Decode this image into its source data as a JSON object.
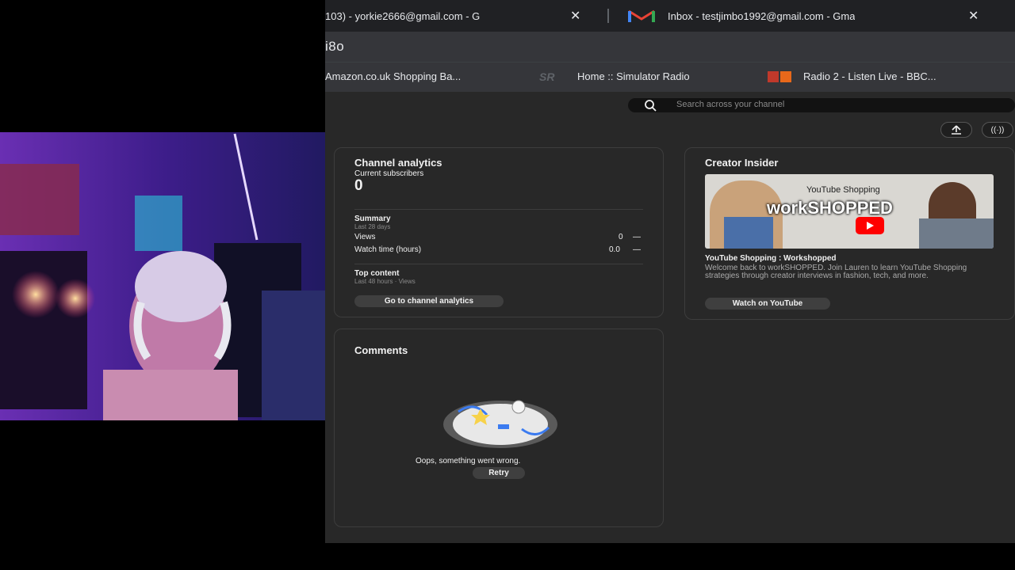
{
  "browser": {
    "tabs": [
      {
        "title": "103) - yorkie2666@gmail.com - G"
      },
      {
        "title": "Inbox - testjimbo1992@gmail.com - Gma"
      }
    ],
    "address_fragment": "i8o",
    "bookmarks": [
      {
        "label": "Amazon.co.uk Shopping Ba..."
      },
      {
        "label": "Home :: Simulator Radio",
        "icon_text": "SR"
      },
      {
        "label": "Radio 2 - Listen Live - BBC..."
      }
    ]
  },
  "studio": {
    "search_placeholder": "Search across your channel",
    "upload_icon": "upload-icon",
    "live_icon": "live-icon",
    "live_glyph": "((·))",
    "analytics": {
      "title": "Channel analytics",
      "subs_label": "Current subscribers",
      "subs_value": "0",
      "summary_title": "Summary",
      "summary_period": "Last 28 days",
      "rows": [
        {
          "label": "Views",
          "value": "0",
          "trend": "—"
        },
        {
          "label": "Watch time (hours)",
          "value": "0.0",
          "trend": "—"
        }
      ],
      "top_title": "Top content",
      "top_period": "Last 48 hours · Views",
      "button": "Go to channel analytics"
    },
    "comments": {
      "title": "Comments",
      "error": "Oops, something went wrong.",
      "retry": "Retry"
    },
    "insider": {
      "title": "Creator Insider",
      "thumb_badge": "YouTube Shopping",
      "thumb_title": "workSHOPPED",
      "video_title": "YouTube Shopping : Workshopped",
      "description": "Welcome back to workSHOPPED. Join Lauren to learn YouTube Shopping strategies through creator interviews in fashion, tech, and more.",
      "button": "Watch on YouTube"
    }
  },
  "colors": {
    "page_bg": "#282828",
    "card_border": "#3d3d3d",
    "tab_bg": "#202124",
    "youtube_red": "#ff0000"
  }
}
